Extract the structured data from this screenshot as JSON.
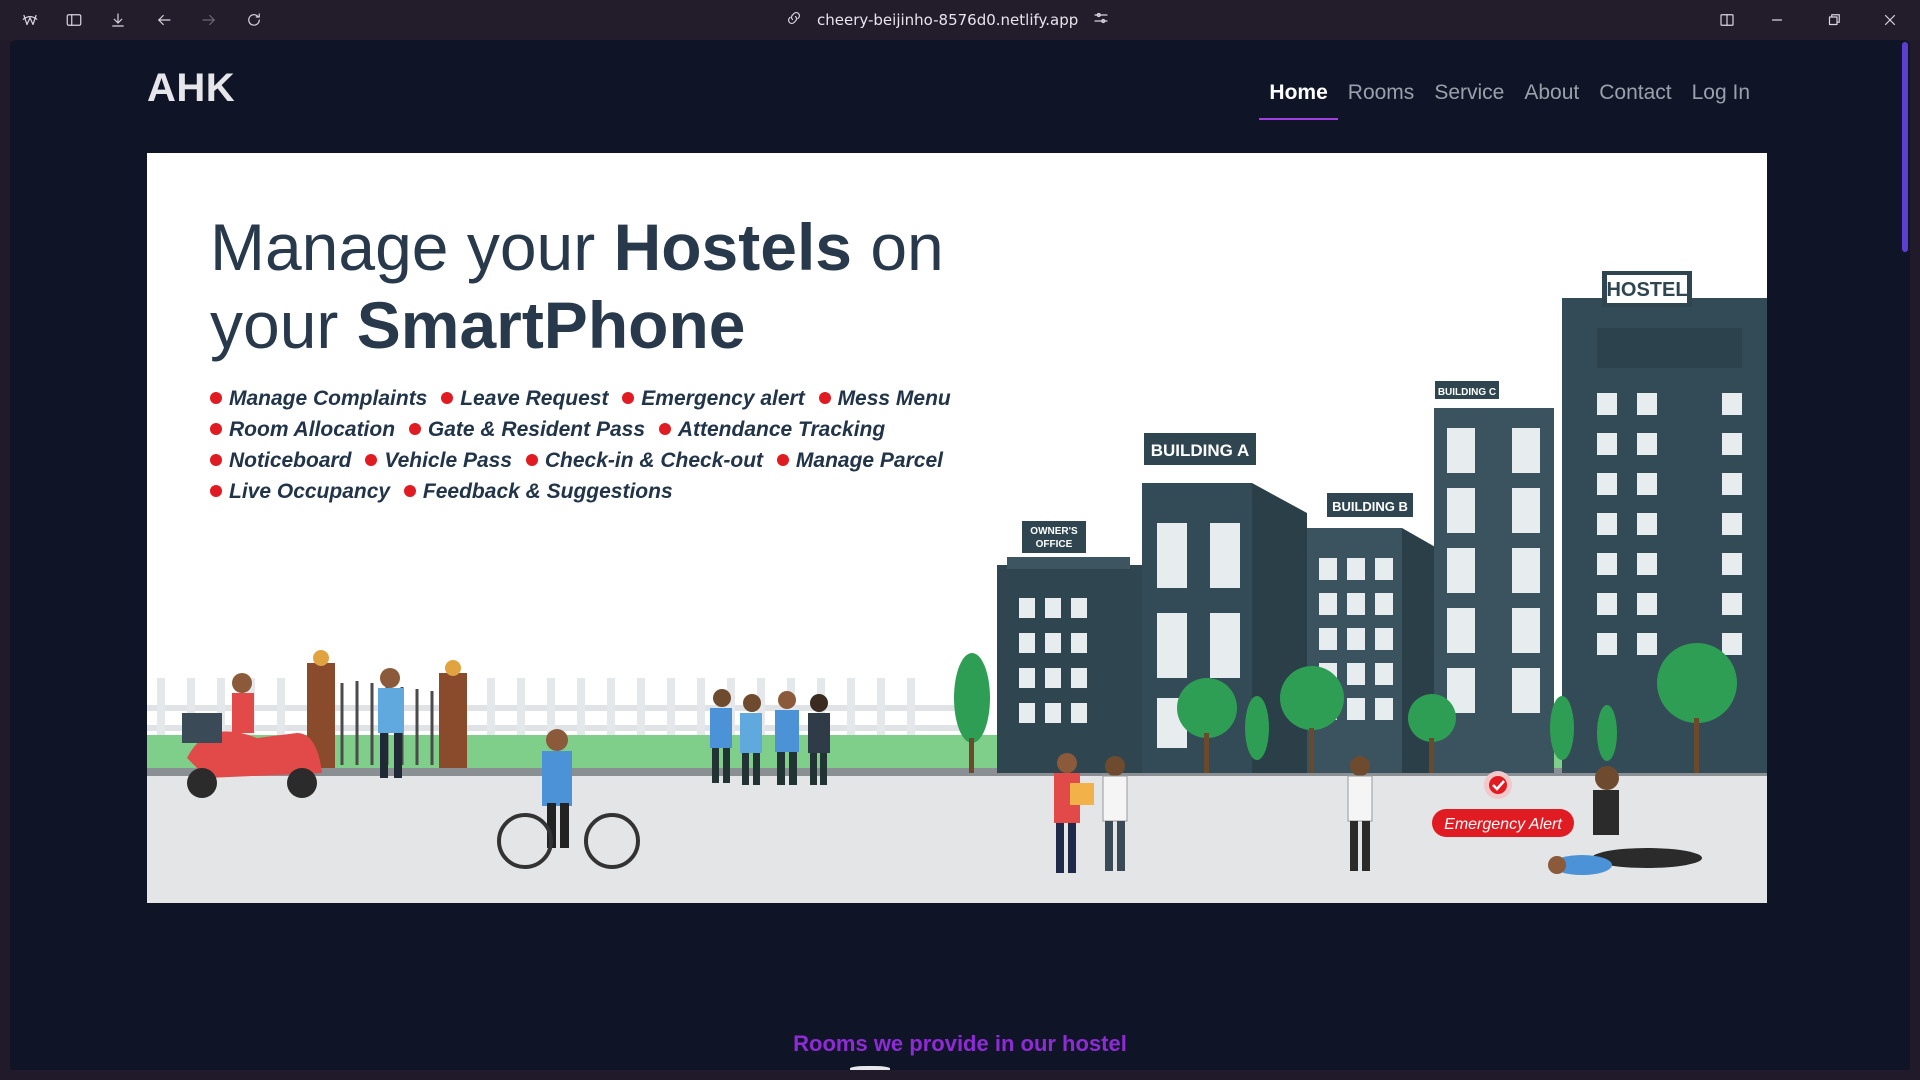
{
  "browser": {
    "url": "cheery-beijinho-8576d0.netlify.app",
    "icons": [
      "logo-icon",
      "sidebar-icon",
      "download-icon",
      "back-icon",
      "forward-icon",
      "reload-icon",
      "link-icon",
      "tune-icon",
      "split-view-icon",
      "minimize-icon",
      "restore-icon",
      "close-icon"
    ]
  },
  "site": {
    "logo": "AHK",
    "nav": [
      {
        "label": "Home",
        "active": true
      },
      {
        "label": "Rooms",
        "active": false
      },
      {
        "label": "Service",
        "active": false
      },
      {
        "label": "About",
        "active": false
      },
      {
        "label": "Contact",
        "active": false
      },
      {
        "label": "Log In",
        "active": false
      }
    ]
  },
  "hero": {
    "title_line1_a": "Manage your ",
    "title_line1_b": "Hostels",
    "title_line1_c": " on",
    "title_line2_a": "your ",
    "title_line2_b": "SmartPhone",
    "features": [
      [
        "Manage Complaints",
        "Leave Request",
        "Emergency alert",
        "Mess Menu"
      ],
      [
        "Room Allocation",
        "Gate & Resident Pass",
        "Attendance Tracking"
      ],
      [
        "Noticeboard",
        "Vehicle Pass",
        "Check-in & Check-out",
        "Manage Parcel"
      ],
      [
        "Live Occupancy",
        "Feedback & Suggestions"
      ]
    ],
    "labels": {
      "hostel": "HOSTEL",
      "building_a": "BUILDING A",
      "building_b": "BUILDING B",
      "building_c": "BUILDING C",
      "owners_office_1": "OWNER'S",
      "owners_office_2": "OFFICE",
      "emergency": "Emergency Alert"
    }
  },
  "section": {
    "title": "Rooms we provide in our hostel"
  },
  "colors": {
    "page_bg": "#0f1527",
    "accent": "#a23fe0",
    "section_title": "#8e2bd6",
    "building": "#334b57",
    "alert_red": "#e11b22"
  }
}
